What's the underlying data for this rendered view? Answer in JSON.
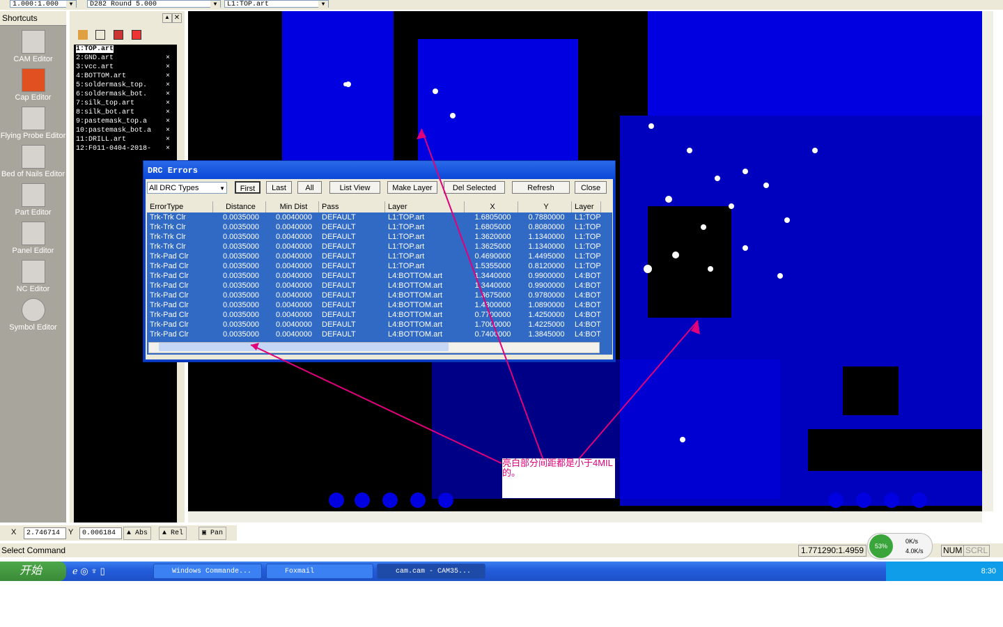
{
  "toolbar": {
    "scale": "1.000:1.000",
    "aperture": "D282  Round 5.000",
    "layer": "L1:TOP.art"
  },
  "shortcuts": {
    "title": "Shortcuts",
    "items": [
      "CAM Editor",
      "Cap Editor",
      "Flying Probe Editor",
      "Bed of Nails Editor",
      "Part Editor",
      "Panel Editor",
      "NC Editor",
      "Symbol Editor"
    ]
  },
  "layers": [
    "1:TOP.art",
    "2:GND.art",
    "3:vcc.art",
    "4:BOTTOM.art",
    "5:soldermask_top.",
    "6:soldermask_bot.",
    "7:silk_top.art",
    "8:silk_bot.art",
    "9:pastemask_top.a",
    "10:pastemask_bot.a",
    "11:DRILL.art",
    "12:F011-0404-2018-"
  ],
  "layer_close": "×",
  "drc": {
    "title": "DRC Errors",
    "filter": "All DRC Types",
    "buttons": {
      "first": "First",
      "last": "Last",
      "all": "All",
      "list_view": "List View",
      "make_layer": "Make Layer",
      "del_selected": "Del Selected",
      "refresh": "Refresh",
      "close": "Close"
    },
    "columns": [
      "ErrorType",
      "Distance",
      "Min Dist",
      "Pass",
      "Layer",
      "X",
      "Y",
      "Layer"
    ],
    "rows": [
      [
        "Trk-Trk Clr",
        "0.0035000",
        "0.0040000",
        "DEFAULT",
        "L1:TOP.art",
        "1.6805000",
        "0.7880000",
        "L1:TOP"
      ],
      [
        "Trk-Trk Clr",
        "0.0035000",
        "0.0040000",
        "DEFAULT",
        "L1:TOP.art",
        "1.6805000",
        "0.8080000",
        "L1:TOP"
      ],
      [
        "Trk-Trk Clr",
        "0.0035000",
        "0.0040000",
        "DEFAULT",
        "L1:TOP.art",
        "1.3620000",
        "1.1340000",
        "L1:TOP"
      ],
      [
        "Trk-Trk Clr",
        "0.0035000",
        "0.0040000",
        "DEFAULT",
        "L1:TOP.art",
        "1.3625000",
        "1.1340000",
        "L1:TOP"
      ],
      [
        "Trk-Pad Clr",
        "0.0035000",
        "0.0040000",
        "DEFAULT",
        "L1:TOP.art",
        "0.4690000",
        "1.4495000",
        "L1:TOP"
      ],
      [
        "Trk-Pad Clr",
        "0.0035000",
        "0.0040000",
        "DEFAULT",
        "L1:TOP.art",
        "1.5355000",
        "0.8120000",
        "L1:TOP"
      ],
      [
        "Trk-Pad Clr",
        "0.0035000",
        "0.0040000",
        "DEFAULT",
        "L4:BOTTOM.art",
        "1.3440000",
        "0.9900000",
        "L4:BOT"
      ],
      [
        "Trk-Pad Clr",
        "0.0035000",
        "0.0040000",
        "DEFAULT",
        "L4:BOTTOM.art",
        "1.3440000",
        "0.9900000",
        "L4:BOT"
      ],
      [
        "Trk-Pad Clr",
        "0.0035000",
        "0.0040000",
        "DEFAULT",
        "L4:BOTTOM.art",
        "1.3675000",
        "0.9780000",
        "L4:BOT"
      ],
      [
        "Trk-Pad Clr",
        "0.0035000",
        "0.0040000",
        "DEFAULT",
        "L4:BOTTOM.art",
        "1.4300000",
        "1.0890000",
        "L4:BOT"
      ],
      [
        "Trk-Pad Clr",
        "0.0035000",
        "0.0040000",
        "DEFAULT",
        "L4:BOTTOM.art",
        "0.7700000",
        "1.4250000",
        "L4:BOT"
      ],
      [
        "Trk-Pad Clr",
        "0.0035000",
        "0.0040000",
        "DEFAULT",
        "L4:BOTTOM.art",
        "1.7000000",
        "1.4225000",
        "L4:BOT"
      ],
      [
        "Trk-Pad Clr",
        "0.0035000",
        "0.0040000",
        "DEFAULT",
        "L4:BOTTOM.art",
        "0.7400000",
        "1.3845000",
        "L4:BOT"
      ]
    ]
  },
  "annotation": "亮白部分间距都是小于4MIL的。",
  "coords": {
    "x_label": "X",
    "x": "2.746714",
    "y_label": "Y",
    "y": "0.006184",
    "abs": "Abs",
    "rel": "Rel",
    "pan": "Pan"
  },
  "status": {
    "text": "Select Command",
    "position": "1.771290:1.4959",
    "num": "NUM",
    "scrl": "SCRL",
    "cpu": "53%",
    "up": "0K/s",
    "down": "4.0K/s"
  },
  "taskbar": {
    "start": "开始",
    "tasks": [
      "Windows Commande...",
      "Foxmail",
      "cam.cam - CAM35..."
    ],
    "clock": "8:30"
  },
  "colors": {
    "pcb_copper": "#0000e0",
    "annotation": "#e0007a",
    "selection": "#316ac5"
  }
}
